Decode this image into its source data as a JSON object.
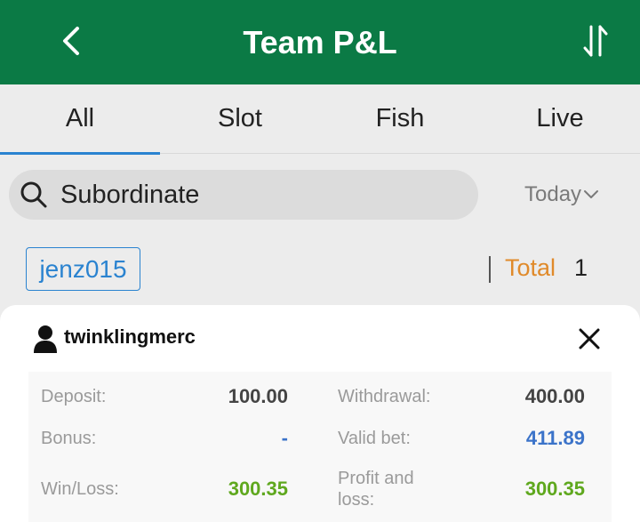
{
  "header": {
    "title": "Team P&L",
    "back_icon": "back-arrow-icon",
    "sort_icon": "sort-arrows-icon"
  },
  "tabs": [
    {
      "label": "All",
      "active": true
    },
    {
      "label": "Slot",
      "active": false
    },
    {
      "label": "Fish",
      "active": false
    },
    {
      "label": "Live",
      "active": false
    }
  ],
  "search": {
    "icon": "search-icon",
    "label": "Subordinate"
  },
  "date_filter": {
    "value": "Today",
    "icon": "chevron-down-icon"
  },
  "filter_row": {
    "user": "jenz015",
    "total_label": "Total",
    "total_value": "1"
  },
  "detail": {
    "username": "twinklingmerc",
    "deposit_label": "Deposit:",
    "deposit_value": "100.00",
    "withdrawal_label": "Withdrawal:",
    "withdrawal_value": "400.00",
    "bonus_label": "Bonus:",
    "bonus_value": "-",
    "valid_bet_label": "Valid bet:",
    "valid_bet_value": "411.89",
    "winloss_label": "Win/Loss:",
    "winloss_value": "300.35",
    "pnl_label_line1": "Profit and",
    "pnl_label_line2": "loss:",
    "pnl_value": "300.35"
  },
  "colors": {
    "header_bg": "#0b7a45",
    "accent_blue": "#2a83d0",
    "total_orange": "#e08a2a",
    "value_green": "#5fa81e",
    "value_blue": "#3b73c9"
  }
}
